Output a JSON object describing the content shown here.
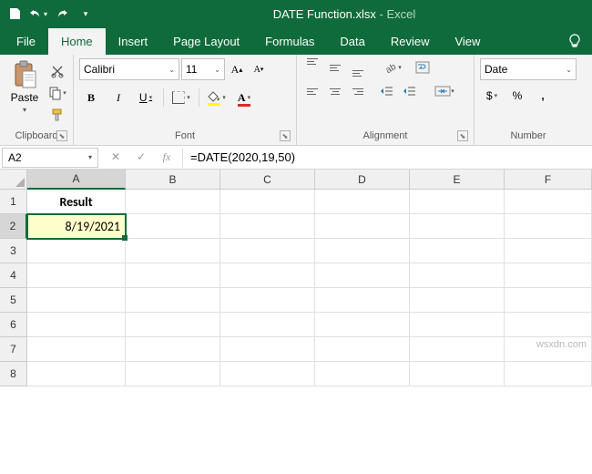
{
  "app": {
    "filename": "DATE Function.xlsx",
    "suffix": "Excel"
  },
  "qat": {
    "save": "save-icon",
    "undo": "undo-icon",
    "redo": "redo-icon"
  },
  "tabs": [
    "File",
    "Home",
    "Insert",
    "Page Layout",
    "Formulas",
    "Data",
    "Review",
    "View"
  ],
  "active_tab": "Home",
  "ribbon": {
    "clipboard": {
      "label": "Clipboard",
      "paste": "Paste"
    },
    "font": {
      "label": "Font",
      "name": "Calibri",
      "size": "11",
      "bold": "B",
      "italic": "I",
      "underline": "U",
      "fontcolor_letter": "A"
    },
    "alignment": {
      "label": "Alignment"
    },
    "number": {
      "label": "Number",
      "format": "Date",
      "dollar": "$",
      "percent": "%",
      "comma": ","
    }
  },
  "namebox": "A2",
  "formula": "=DATE(2020,19,50)",
  "columns": [
    "A",
    "B",
    "C",
    "D",
    "E",
    "F"
  ],
  "rows": [
    "1",
    "2",
    "3",
    "4",
    "5",
    "6",
    "7",
    "8"
  ],
  "cells": {
    "A1": "Result",
    "A2": "8/19/2021"
  },
  "selected_cell": "A2",
  "watermark": "wsxdn.com",
  "chart_data": null
}
